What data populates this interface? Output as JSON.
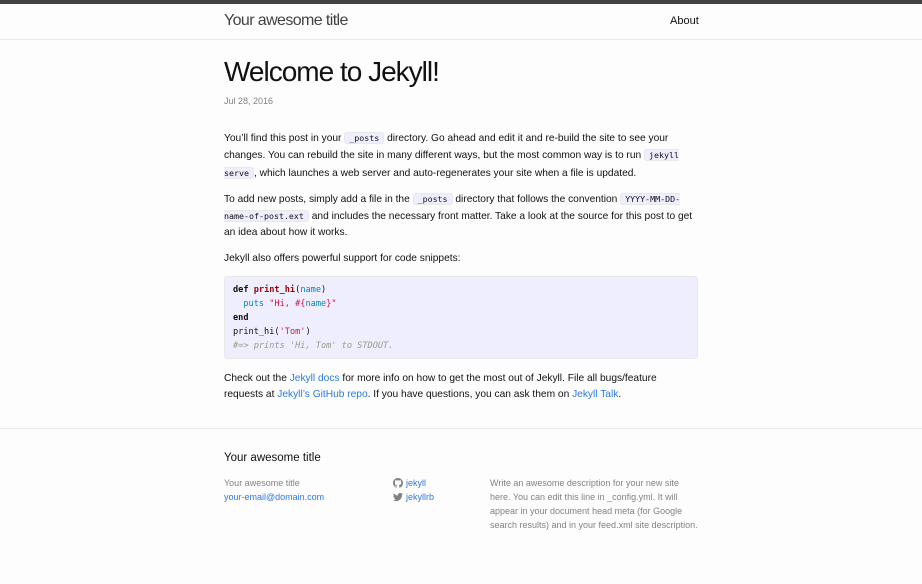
{
  "header": {
    "site_title": "Your awesome title",
    "nav": {
      "about": "About"
    }
  },
  "post": {
    "title": "Welcome to Jekyll!",
    "date": "Jul 28, 2016",
    "p1": {
      "t1": "You’ll find this post in your ",
      "code1": "_posts",
      "t2": " directory. Go ahead and edit it and re-build the site to see your changes. You can rebuild the site in many different ways, but the most common way is to run ",
      "code2": "jekyll serve",
      "t3": ", which launches a web server and auto-regenerates your site when a file is updated."
    },
    "p2": {
      "t1": "To add new posts, simply add a file in the ",
      "code1": "_posts",
      "t2": " directory that follows the convention ",
      "code2": "YYYY-MM-DD-name-of-post.ext",
      "t3": " and includes the necessary front matter. Take a look at the source for this post to get an idea about how it works."
    },
    "p3": "Jekyll also offers powerful support for code snippets:",
    "code": {
      "l1_kw": "def",
      "l1_fn": "print_hi",
      "l1_open": "(",
      "l1_arg": "name",
      "l1_close": ")",
      "l2_fn": "puts",
      "l2_str1": "\"Hi, ",
      "l2_interp": "#{",
      "l2_var": "name",
      "l2_interp_close": "}",
      "l2_str2": "\"",
      "l3_kw": "end",
      "l4_fn": "print_hi",
      "l4_open": "(",
      "l4_str": "'Tom'",
      "l4_close": ")",
      "l5_comment": "#=> prints 'Hi, Tom' to STDOUT."
    },
    "p4": {
      "t1": "Check out the ",
      "link1": "Jekyll docs",
      "t2": " for more info on how to get the most out of Jekyll. File all bugs/feature requests at ",
      "link2": "Jekyll’s GitHub repo",
      "t3": ". If you have questions, you can ask them on ",
      "link3": "Jekyll Talk",
      "t4": "."
    }
  },
  "footer": {
    "heading": "Your awesome title",
    "col1": {
      "name": "Your awesome title",
      "email": "your-email@domain.com"
    },
    "col2": {
      "github_icon": "github-icon",
      "github": "jekyll",
      "twitter_icon": "twitter-icon",
      "twitter": "jekyllrb"
    },
    "col3": {
      "description": "Write an awesome description for your new site here. You can edit this line in _config.yml. It will appear in your document head meta (for Google search results) and in your feed.xml site description."
    }
  },
  "colors": {
    "link": "#2a7ae2",
    "top_bar": "#424242",
    "code_bg": "#eeeeff"
  }
}
